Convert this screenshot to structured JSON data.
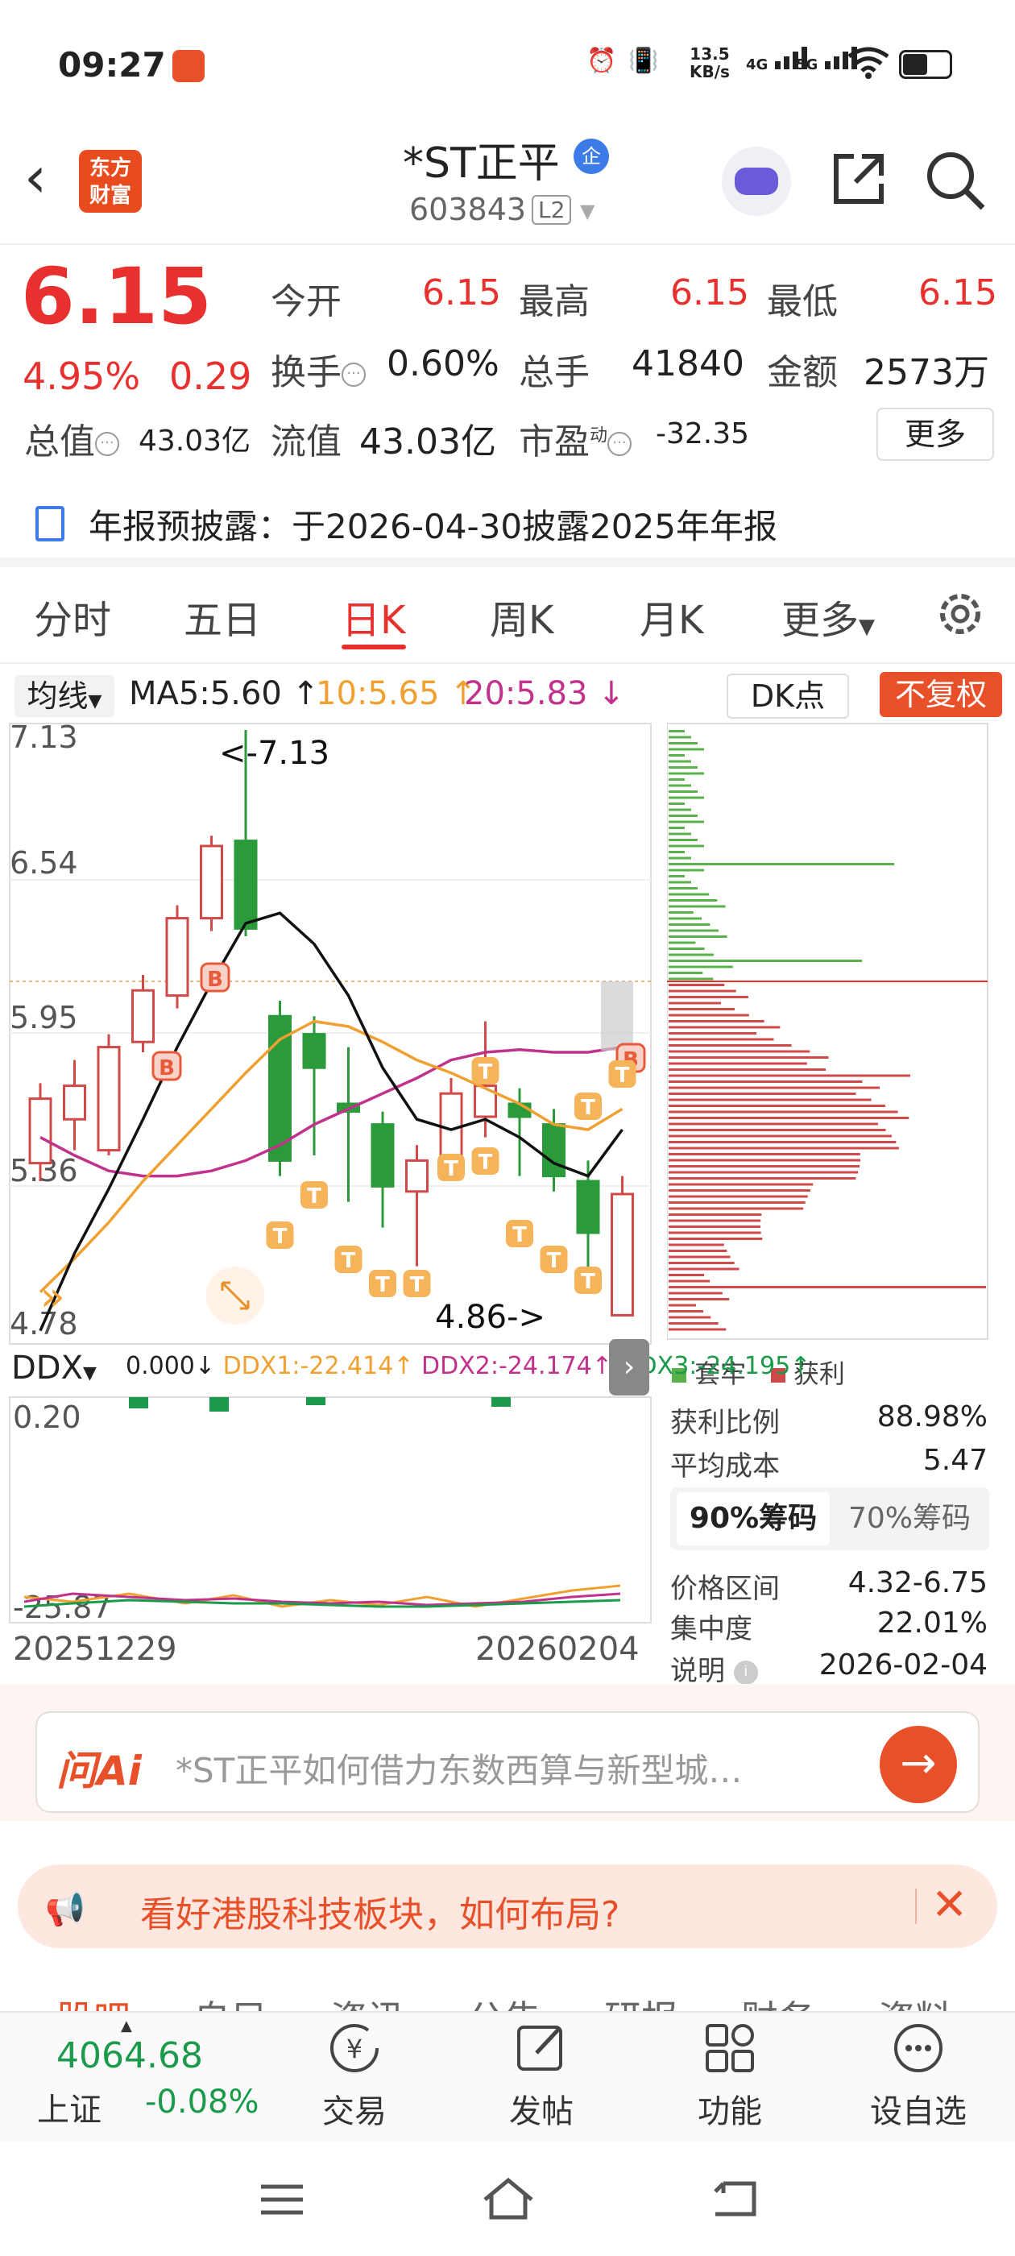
{
  "status_bar": {
    "time": "09:27",
    "net_speed_top": "13.5",
    "net_speed_bottom": "KB/s",
    "sig1": "4G",
    "sig2": "5G"
  },
  "header": {
    "logo_line1": "东方",
    "logo_line2": "财富",
    "stock_name": "*ST正平",
    "badge": "企",
    "stock_code": "603843",
    "level": "L2"
  },
  "quote": {
    "price": "6.15",
    "change_pct": "4.95%",
    "change": "0.29",
    "open_label": "今开",
    "open": "6.15",
    "high_label": "最高",
    "high": "6.15",
    "low_label": "最低",
    "low": "6.15",
    "turnover_label": "换手",
    "turnover": "0.60%",
    "volume_label": "总手",
    "volume": "41840",
    "amount_label": "金额",
    "amount": "2573万",
    "mktcap_label": "总值",
    "mktcap": "43.03亿",
    "float_label": "流值",
    "float": "43.03亿",
    "pe_label": "市盈",
    "pe_sup": "动",
    "pe": "-32.35",
    "more": "更多"
  },
  "notice": "年报预披露：于2026-04-30披露2025年年报",
  "tabs": {
    "t1": "分时",
    "t2": "五日",
    "t3": "日K",
    "t4": "周K",
    "t5": "月K",
    "t6": "更多"
  },
  "indicator": {
    "ma_btn": "均线",
    "ma5": "MA5:5.60 ↑",
    "ma10": "10:5.65 ↑",
    "ma20": "20:5.83 ↓",
    "dk": "DK点",
    "fq": "不复权"
  },
  "chart_data": {
    "type": "candlestick",
    "y_axis_labels": [
      "7.13",
      "6.54",
      "5.95",
      "5.36",
      "4.78"
    ],
    "ylim": [
      4.78,
      7.13
    ],
    "x_range_labels": [
      "20251229",
      "20260204"
    ],
    "annotations": {
      "high": "<-7.13",
      "low": "4.86->"
    },
    "ma_colors": {
      "ma5": "#111111",
      "ma10": "#f0a030",
      "ma20": "#c0328c"
    },
    "candles": [
      {
        "o": 5.45,
        "c": 5.7,
        "h": 5.76,
        "l": 5.38
      },
      {
        "o": 5.62,
        "c": 5.75,
        "h": 5.85,
        "l": 5.5
      },
      {
        "o": 5.5,
        "c": 5.9,
        "h": 5.95,
        "l": 5.48
      },
      {
        "o": 5.92,
        "c": 6.12,
        "h": 6.18,
        "l": 5.88
      },
      {
        "o": 6.1,
        "c": 6.4,
        "h": 6.45,
        "l": 6.05
      },
      {
        "o": 6.4,
        "c": 6.68,
        "h": 6.72,
        "l": 6.35
      },
      {
        "o": 6.7,
        "c": 6.36,
        "h": 7.13,
        "l": 6.33
      },
      {
        "o": 6.02,
        "c": 5.46,
        "h": 6.08,
        "l": 5.4
      },
      {
        "o": 5.95,
        "c": 5.82,
        "h": 6.02,
        "l": 5.48
      },
      {
        "o": 5.68,
        "c": 5.65,
        "h": 5.9,
        "l": 5.3
      },
      {
        "o": 5.6,
        "c": 5.36,
        "h": 5.65,
        "l": 5.2
      },
      {
        "o": 5.34,
        "c": 5.46,
        "h": 5.52,
        "l": 5.05
      },
      {
        "o": 5.48,
        "c": 5.72,
        "h": 5.78,
        "l": 5.45
      },
      {
        "o": 5.63,
        "c": 5.75,
        "h": 6.0,
        "l": 5.55
      },
      {
        "o": 5.68,
        "c": 5.63,
        "h": 5.74,
        "l": 5.4
      },
      {
        "o": 5.6,
        "c": 5.4,
        "h": 5.66,
        "l": 5.34
      },
      {
        "o": 5.38,
        "c": 5.18,
        "h": 5.46,
        "l": 5.04
      },
      {
        "o": 4.86,
        "c": 5.33,
        "h": 5.4,
        "l": 4.86
      }
    ],
    "ma5": [
      4.8,
      5.1,
      5.35,
      5.62,
      5.9,
      6.15,
      6.38,
      6.42,
      6.3,
      6.1,
      5.82,
      5.62,
      5.58,
      5.62,
      5.55,
      5.45,
      5.4,
      5.58
    ],
    "ma10": [
      4.95,
      5.08,
      5.22,
      5.38,
      5.52,
      5.66,
      5.8,
      5.93,
      6.0,
      5.98,
      5.92,
      5.85,
      5.8,
      5.74,
      5.68,
      5.6,
      5.58,
      5.66
    ],
    "ma20": [
      5.55,
      5.48,
      5.42,
      5.4,
      5.4,
      5.42,
      5.46,
      5.52,
      5.6,
      5.66,
      5.72,
      5.78,
      5.85,
      5.88,
      5.89,
      5.88,
      5.88,
      5.9
    ],
    "price_line": "6.15",
    "chip_legend_trapped": "套牢",
    "chip_legend_profit": "获利"
  },
  "ddx": {
    "btn": "DDX",
    "v0": "0.000↓",
    "v1": "DDX1:-22.414↑",
    "v2": "DDX2:-24.174↑",
    "v3": "DDX3:-24.195↑",
    "top": "0.20",
    "bottom": "-25.87"
  },
  "chip_panel": {
    "profit_ratio_label": "获利比例",
    "profit_ratio": "88.98%",
    "avg_cost_label": "平均成本",
    "avg_cost": "5.47",
    "seg90": "90%筹码",
    "seg70": "70%筹码",
    "range_label": "价格区间",
    "range": "4.32-6.75",
    "conc_label": "集中度",
    "conc": "22.01%",
    "note_label": "说明",
    "note": "2026-02-04"
  },
  "ask": {
    "logo": "问Ai",
    "placeholder": "*ST正平如何借力东数西算与新型城…"
  },
  "promo": {
    "text": "看好港股科技板块，如何布局?"
  },
  "peek_tabs": [
    "股吧",
    "自目",
    "资讯",
    "公告",
    "研报",
    "财务",
    "资料"
  ],
  "bottom_nav": {
    "index_value": "4064.68",
    "index_name": "上证",
    "index_pct": "-0.08%",
    "trade": "交易",
    "post": "发帖",
    "func": "功能",
    "watch": "设自选"
  }
}
